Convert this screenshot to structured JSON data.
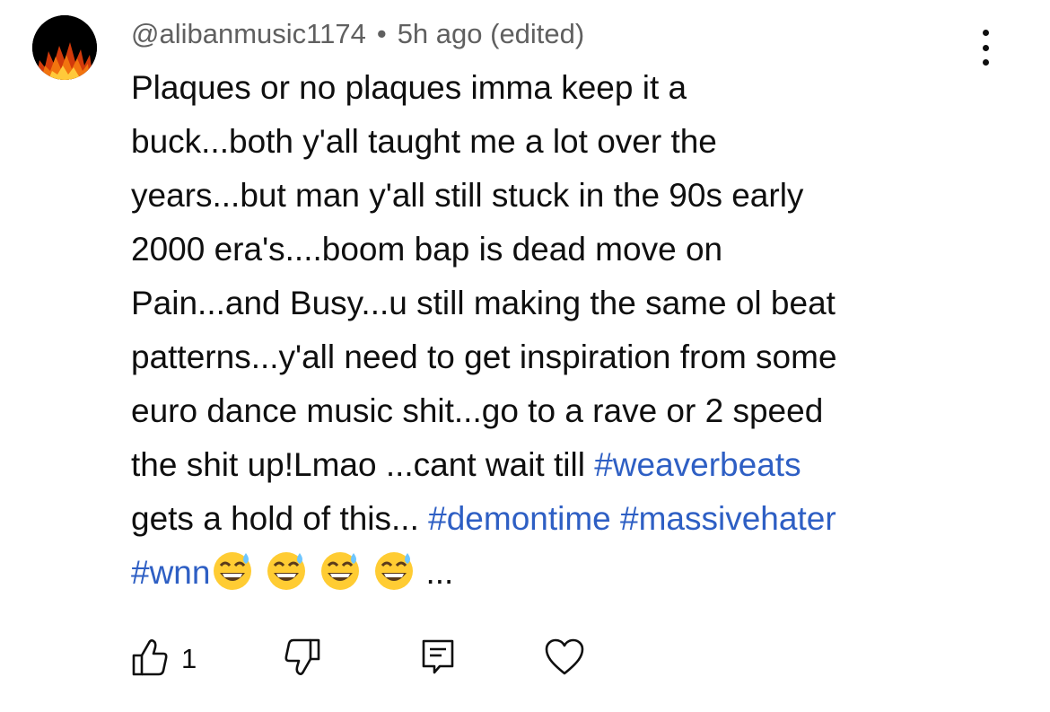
{
  "comment": {
    "author": "@alibanmusic1174",
    "separator": "•",
    "timestamp": "5h ago (edited)",
    "lines": {
      "l1": "Plaques or no plaques imma keep it a",
      "l2": "buck...both y'all taught me a lot over the",
      "l3": "years...but man y'all still stuck in the 90s early",
      "l4": "2000 era's....boom bap is dead move on",
      "l5": "Pain...and Busy...u still making the same ol beat",
      "l6": "patterns...y'all need to get inspiration from some",
      "l7": "euro dance music shit...go to a rave or 2  speed",
      "l8a": "the shit up!Lmao ...cant wait till ",
      "l9a": "gets a hold of this... ",
      "l10b": "..."
    },
    "hashtags": {
      "h1": "#weaverbeats",
      "h2": "#demontime",
      "h3": "#massivehater",
      "h4": "#wnn"
    },
    "emoji": "sweat-smile-emoji",
    "emoji_count": 4
  },
  "actions": {
    "like_count": "1",
    "like_icon": "thumbs-up-icon",
    "dislike_icon": "thumbs-down-icon",
    "reply_icon": "reply-comment-icon",
    "heart_icon": "heart-icon",
    "more_icon": "more-vertical-icon"
  },
  "colors": {
    "text": "#0f0f0f",
    "meta": "#606060",
    "hashtag": "#2e5fc4"
  }
}
